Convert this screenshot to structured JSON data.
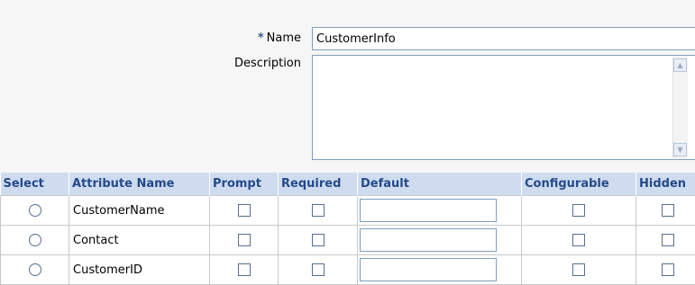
{
  "form": {
    "name_label": "Name",
    "required_marker": "*",
    "name_value": "CustomerInfo",
    "description_label": "Description",
    "description_value": ""
  },
  "table": {
    "columns": [
      "Select",
      "Attribute Name",
      "Prompt",
      "Required",
      "Default",
      "Configurable",
      "Hidden"
    ],
    "rows": [
      {
        "attribute_name": "CustomerName",
        "selected": false,
        "prompt": false,
        "required": false,
        "default": "",
        "configurable": false,
        "hidden": false
      },
      {
        "attribute_name": "Contact",
        "selected": false,
        "prompt": false,
        "required": false,
        "default": "",
        "configurable": false,
        "hidden": false
      },
      {
        "attribute_name": "CustomerID",
        "selected": false,
        "prompt": false,
        "required": false,
        "default": "",
        "configurable": false,
        "hidden": false
      }
    ]
  }
}
